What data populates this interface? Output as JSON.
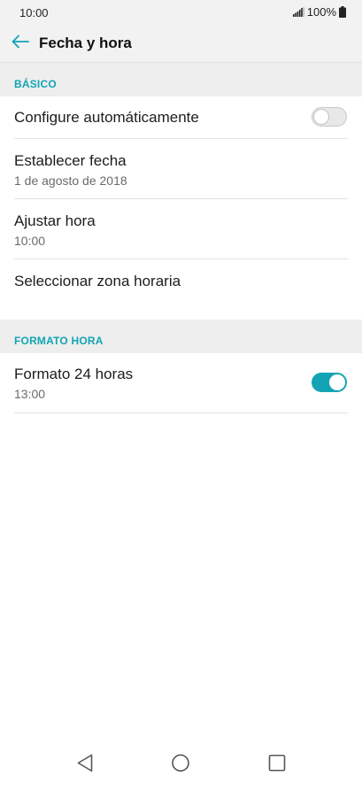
{
  "status_bar": {
    "time": "10:00",
    "battery": "100%"
  },
  "header": {
    "title": "Fecha y hora"
  },
  "sections": {
    "basic": {
      "label": "BÁSICO",
      "auto_config": {
        "title": "Configure automáticamente",
        "enabled": false
      },
      "set_date": {
        "title": "Establecer fecha",
        "value": "1 de agosto de 2018"
      },
      "set_time": {
        "title": "Ajustar hora",
        "value": "10:00"
      },
      "timezone": {
        "title": "Seleccionar zona horaria"
      }
    },
    "time_format": {
      "label": "FORMATO HORA",
      "format_24h": {
        "title": "Formato 24 horas",
        "value": "13:00",
        "enabled": true
      }
    }
  },
  "colors": {
    "accent": "#12a4b4",
    "section_bg": "#eeeeee",
    "status_bg": "#f2f2f2"
  },
  "icons": {
    "back": "arrow-left-icon",
    "signal": "signal-icon",
    "battery": "battery-icon",
    "nav_back": "triangle-back-icon",
    "nav_home": "circle-home-icon",
    "nav_recents": "square-recents-icon"
  }
}
